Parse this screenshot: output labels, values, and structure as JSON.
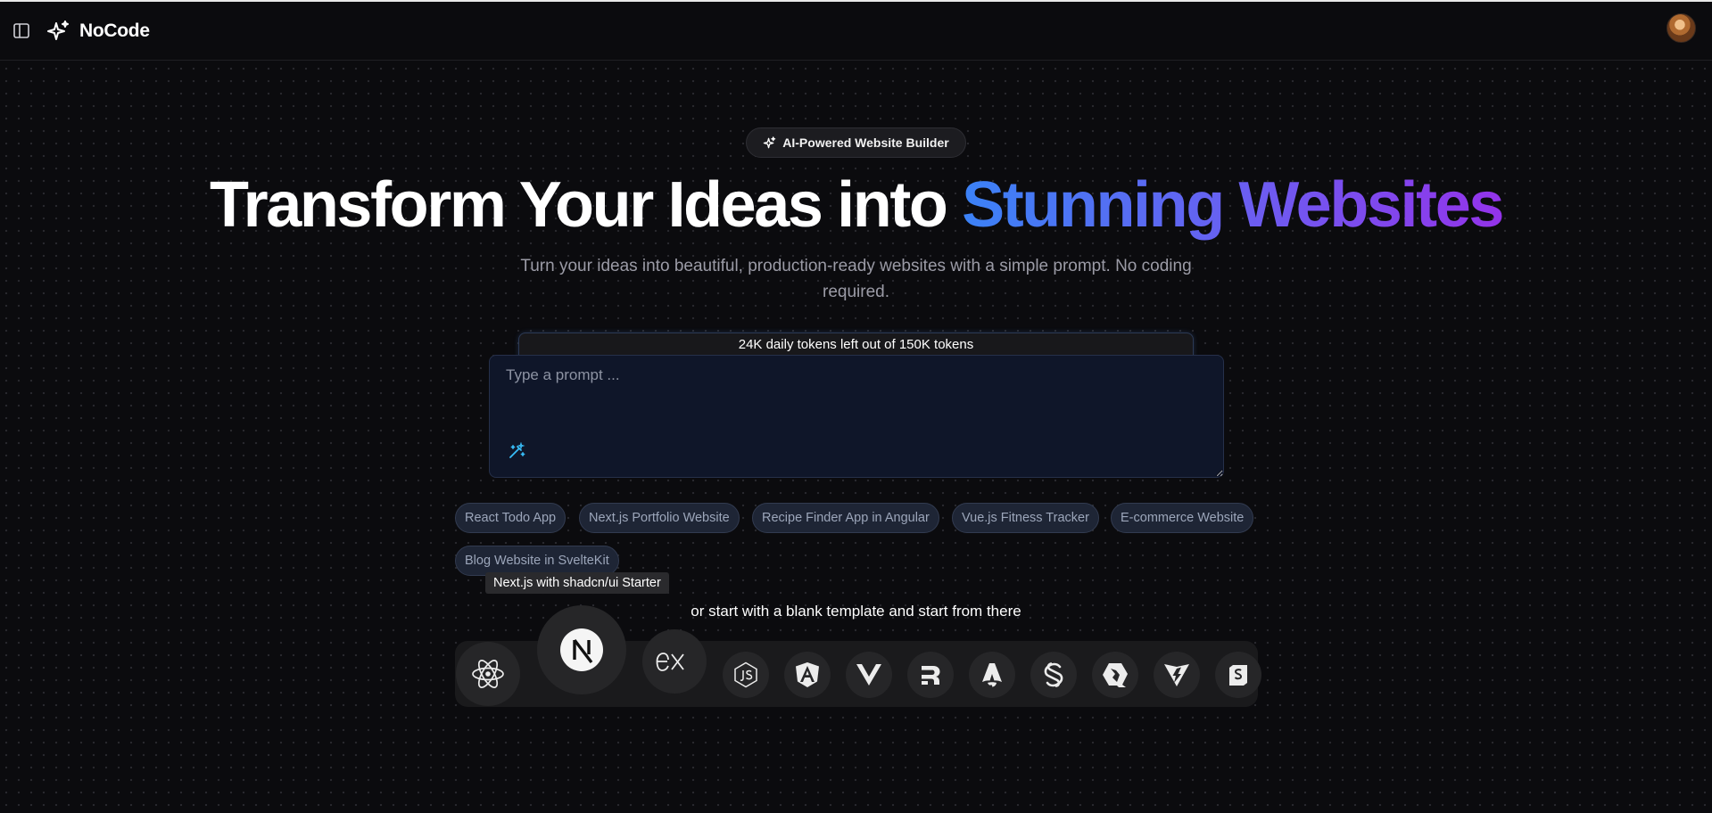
{
  "app": {
    "brand": "NoCode"
  },
  "hero": {
    "badge": "AI-Powered Website Builder",
    "title_main": "Transform Your Ideas into ",
    "title_highlight": "Stunning Websites",
    "subtitle": "Turn your ideas into beautiful, production-ready websites with a simple prompt. No coding required."
  },
  "prompt": {
    "tokens_text": "24K daily tokens left out of 150K tokens",
    "placeholder": "Type a prompt ...",
    "value": ""
  },
  "suggestions": [
    "React Todo App",
    "Next.js Portfolio Website",
    "Recipe Finder App in Angular",
    "Vue.js Fitness Tracker",
    "E-commerce Website",
    "Blog Website in SvelteKit"
  ],
  "templates": {
    "tooltip": "Next.js with shadcn/ui Starter",
    "blank_text": "or start with a blank template and start from there",
    "items": [
      "react-icon",
      "nextjs-icon",
      "express-icon",
      "nodejs-icon",
      "angular-icon",
      "vue-icon",
      "remix-icon",
      "astro-icon",
      "svelte-icon",
      "qwik-icon",
      "vite-icon",
      "shadcn-icon"
    ]
  },
  "colors": {
    "background": "#0b0b0e",
    "gradient_start": "#3b82f6",
    "gradient_end": "#9333ea",
    "chip_bg": "#1e2535",
    "prompt_bg": "#0f1629"
  }
}
